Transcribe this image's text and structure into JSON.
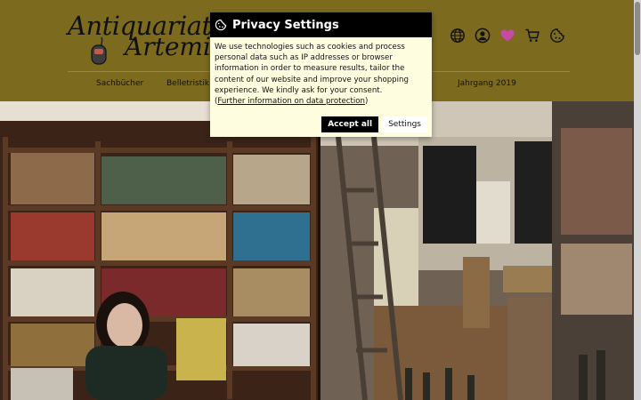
{
  "header": {
    "logo": {
      "line1": "Antiquariat",
      "line2": "Artemis"
    },
    "icons": [
      "globe-icon",
      "account-icon",
      "heart-icon",
      "cart-icon",
      "cookie-icon"
    ],
    "accent_heart": "#c64ba7"
  },
  "nav": {
    "items": [
      {
        "label": "Sachbücher"
      },
      {
        "label": "Belletristik"
      },
      {
        "label": "Jahrgang 2019"
      }
    ]
  },
  "privacy": {
    "title": "Privacy Settings",
    "body": "We use technologies such as cookies and process personal data such as IP addresses or browser information in order to measure results, tailor the content of our website and improve your shopping experience. We kindly ask for your consent.",
    "link_label": "Further information on data protection",
    "accept_label": "Accept all",
    "settings_label": "Settings"
  },
  "colors": {
    "header_bg": "#7c6a1f",
    "modal_bg": "#fffde0"
  }
}
